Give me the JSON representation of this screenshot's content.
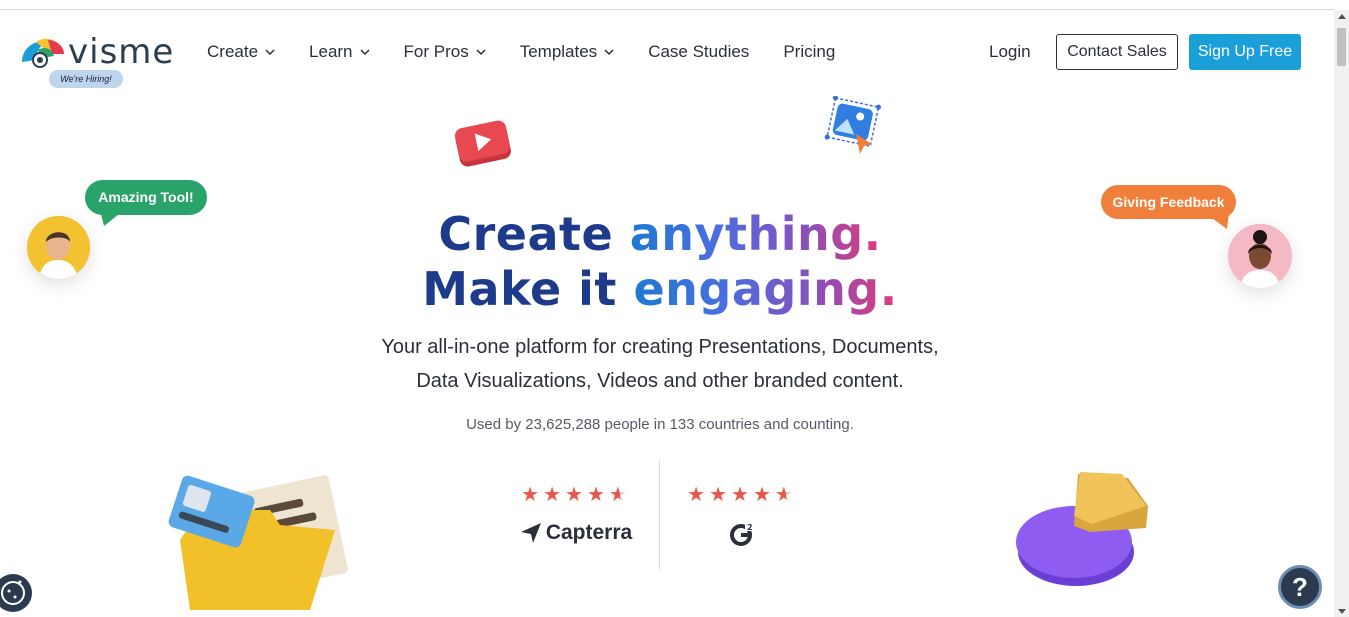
{
  "header": {
    "logo_text": "visme",
    "hiring_badge": "We're Hiring!",
    "nav": [
      {
        "label": "Create",
        "dropdown": true
      },
      {
        "label": "Learn",
        "dropdown": true
      },
      {
        "label": "For Pros",
        "dropdown": true
      },
      {
        "label": "Templates",
        "dropdown": true
      },
      {
        "label": "Case Studies",
        "dropdown": false
      },
      {
        "label": "Pricing",
        "dropdown": false
      }
    ],
    "login_label": "Login",
    "contact_sales_label": "Contact Sales",
    "signup_label": "Sign Up Free"
  },
  "hero": {
    "line1_a": "Create ",
    "line1_b": "anything.",
    "line2_a": "Make it ",
    "line2_b": "engaging.",
    "subtitle_1": "Your all-in-one platform for creating Presentations, Documents,",
    "subtitle_2": "Data Visualizations, Videos and other branded content.",
    "used_by": "Used by 23,625,288 people in 133 countries and counting."
  },
  "bubbles": {
    "left": "Amazing Tool!",
    "right": "Giving Feedback"
  },
  "ratings": [
    {
      "stars": 4.5,
      "brand": "Capterra"
    },
    {
      "stars": 4.5,
      "brand": "G2"
    }
  ],
  "help_label": "?",
  "colors": {
    "primary_button": "#1a9fd9",
    "bubble_green": "#2aa36b",
    "bubble_orange": "#f07f3c",
    "star": "#e8584a",
    "headline_navy": "#1e3a8a"
  }
}
